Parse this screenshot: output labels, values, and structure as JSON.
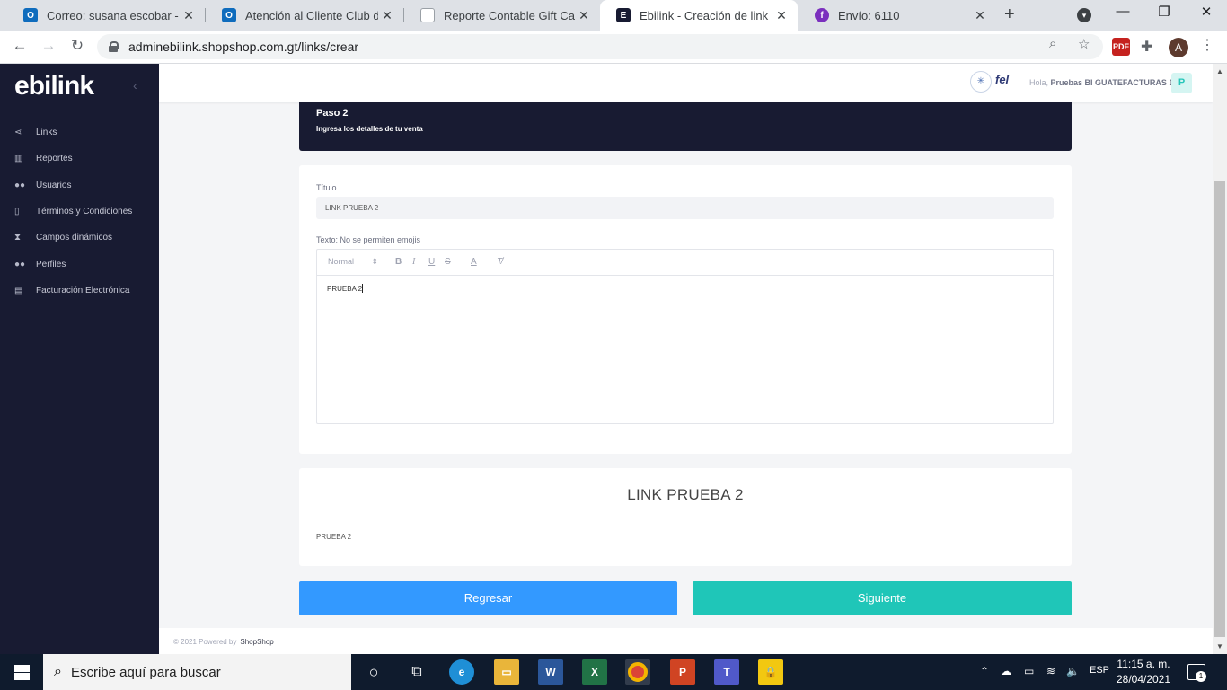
{
  "browser": {
    "tabs": [
      {
        "title": "Correo: susana escobar - Outlook",
        "icon": "outlook-icon",
        "color": "#0f6cbd"
      },
      {
        "title": "Atención al Cliente Club de Compras",
        "icon": "outlook-icon",
        "color": "#0f6cbd"
      },
      {
        "title": "Reporte Contable Gift Cards - Google Sheets",
        "icon": "document-icon",
        "color": "#9aa0a6"
      },
      {
        "title": "Ebilink - Creación de link",
        "icon": "ebilink-icon",
        "color": "#181b32"
      },
      {
        "title": "Envío: 6110",
        "icon": "purple-circle-icon",
        "color": "#7b2fbe"
      }
    ],
    "url": "adminebilink.shopshop.com.gt/links/crear",
    "profile_initial": "A"
  },
  "app": {
    "logo": "ebilink",
    "sidebar": {
      "items": [
        {
          "label": "Links",
          "icon": "share-icon"
        },
        {
          "label": "Reportes",
          "icon": "bar-chart-icon"
        },
        {
          "label": "Usuarios",
          "icon": "users-icon"
        },
        {
          "label": "Términos y Condiciones",
          "icon": "document-icon"
        },
        {
          "label": "Campos dinámicos",
          "icon": "hourglass-icon"
        },
        {
          "label": "Perfiles",
          "icon": "profiles-icon"
        },
        {
          "label": "Facturación Electrónica",
          "icon": "invoice-icon"
        }
      ]
    },
    "header": {
      "fel_label": "fel",
      "greeting": "Hola,",
      "user_name": "Pruebas BI GUATEFACTURAS 1",
      "avatar_initial": "P"
    },
    "step": {
      "title": "Paso 2",
      "subtitle": "Ingresa los detalles de tu venta"
    },
    "form": {
      "title_label": "Título",
      "title_value": "LINK PRUEBA 2",
      "text_label": "Texto: No se permiten emojis",
      "editor_format": "Normal",
      "editor_content": "PRUEBA 2"
    },
    "preview": {
      "title": "LINK PRUEBA 2",
      "text": "PRUEBA 2"
    },
    "buttons": {
      "back": "Regresar",
      "next": "Siguiente"
    },
    "footer": {
      "copyright": "© 2021 Powered by",
      "brand": "ShopShop"
    },
    "colors": {
      "sidebar_bg": "#181b32",
      "back_button": "#3399ff",
      "next_button": "#1fc6b8"
    }
  },
  "taskbar": {
    "search_placeholder": "Escribe aquí para buscar",
    "language": "ESP",
    "time": "11:15 a. m.",
    "date": "28/04/2021",
    "notification_count": "1"
  }
}
